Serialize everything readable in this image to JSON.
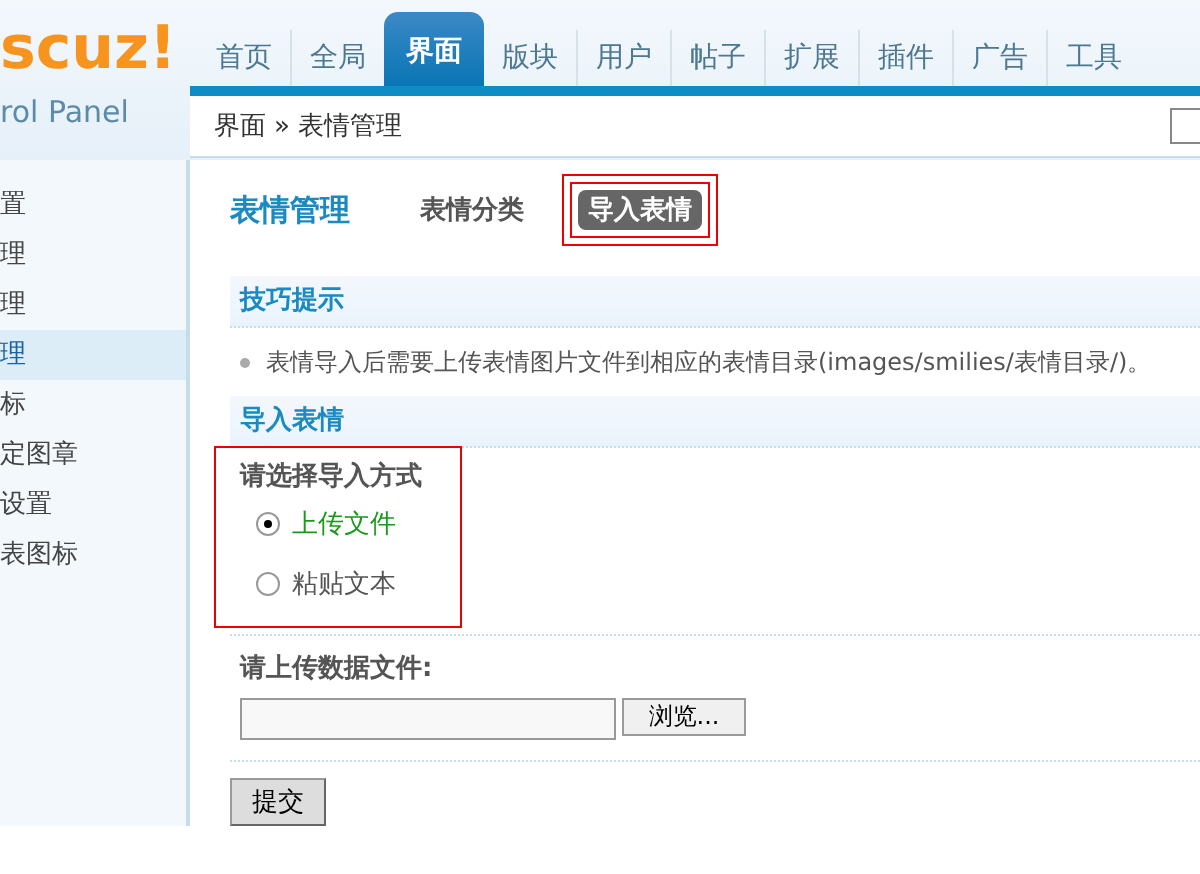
{
  "logo": {
    "mark": "scuz!",
    "subtitle": "rol Panel"
  },
  "nav": [
    {
      "label": "首页",
      "selected": false
    },
    {
      "label": "全局",
      "selected": false
    },
    {
      "label": "界面",
      "selected": true
    },
    {
      "label": "版块",
      "selected": false
    },
    {
      "label": "用户",
      "selected": false
    },
    {
      "label": "帖子",
      "selected": false
    },
    {
      "label": "扩展",
      "selected": false
    },
    {
      "label": "插件",
      "selected": false
    },
    {
      "label": "广告",
      "selected": false
    },
    {
      "label": "工具",
      "selected": false
    }
  ],
  "breadcrumb": {
    "items": [
      "界面",
      "表情管理"
    ],
    "separator": "»"
  },
  "sidebar": [
    {
      "label": "置",
      "selected": false
    },
    {
      "label": "理",
      "selected": false
    },
    {
      "label": "理",
      "selected": false
    },
    {
      "label": "理",
      "selected": true
    },
    {
      "label": "标",
      "selected": false
    },
    {
      "label": "定图章",
      "selected": false
    },
    {
      "label": "设置",
      "selected": false
    },
    {
      "label": "表图标",
      "selected": false
    }
  ],
  "page": {
    "title": "表情管理",
    "tabs": [
      {
        "label": "表情分类",
        "selected": false,
        "highlighted": false
      },
      {
        "label": "导入表情",
        "selected": true,
        "highlighted": true
      }
    ]
  },
  "tips": {
    "heading": "技巧提示",
    "items": [
      "表情导入后需要上传表情图片文件到相应的表情目录(images/smilies/表情目录/)。"
    ]
  },
  "import": {
    "heading": "导入表情",
    "method": {
      "label": "请选择导入方式",
      "highlighted": true,
      "options": [
        {
          "label": "上传文件",
          "selected": true
        },
        {
          "label": "粘贴文本",
          "selected": false
        }
      ]
    },
    "file": {
      "label": "请上传数据文件:",
      "browse": "浏览..."
    },
    "submit": "提交"
  }
}
